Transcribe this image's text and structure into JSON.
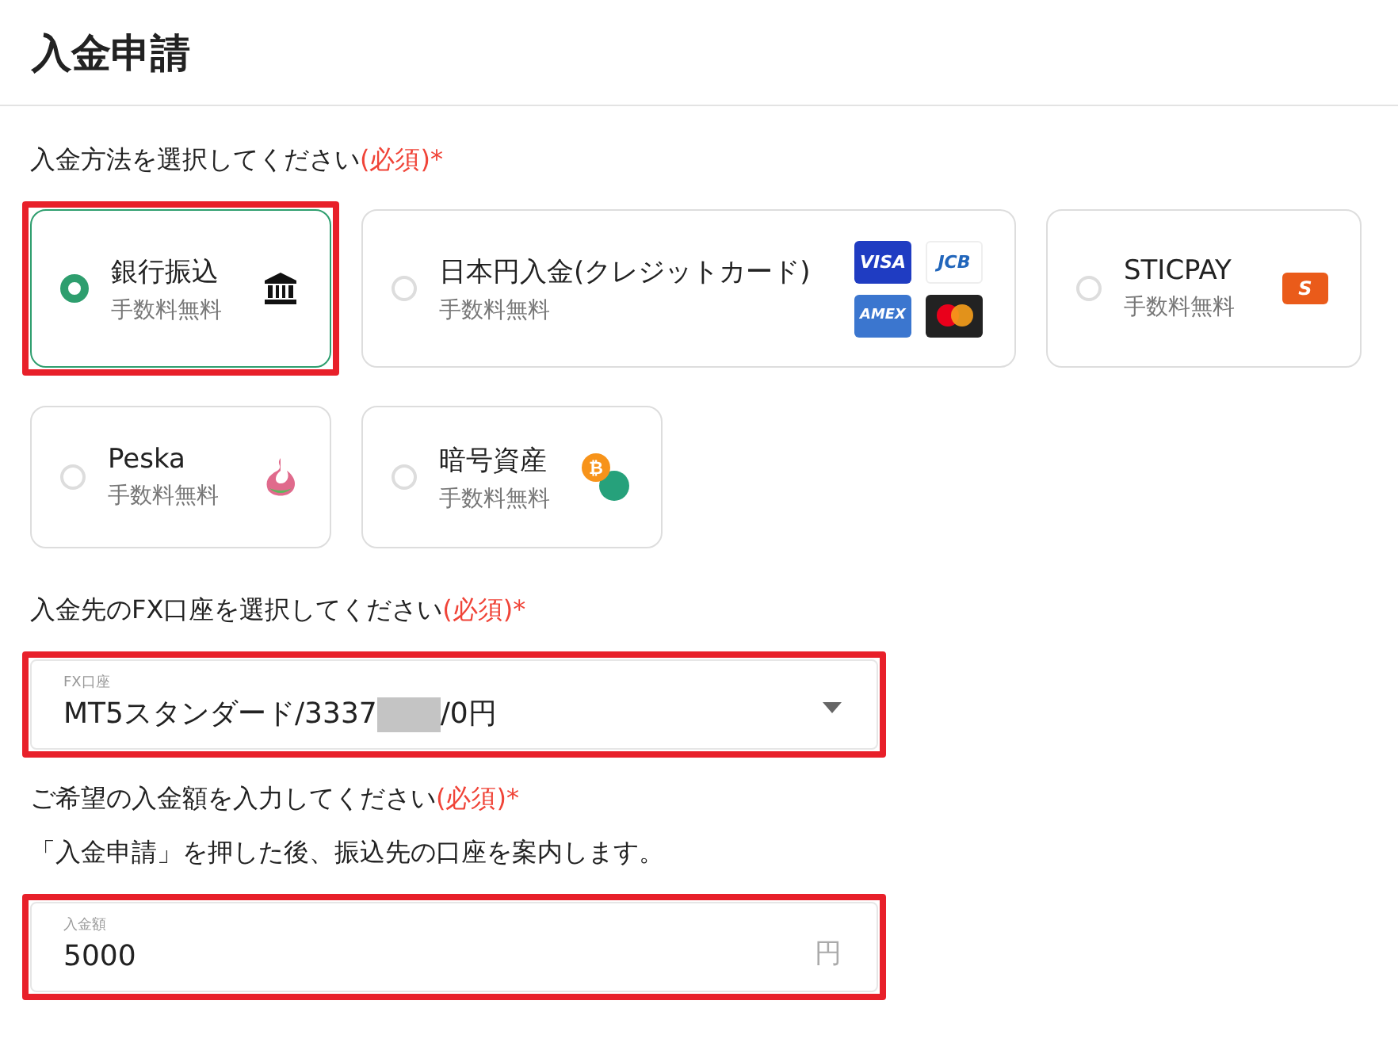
{
  "page_title": "入金申請",
  "method_section": {
    "label": "入金方法を選択してください",
    "required": "(必須)*"
  },
  "methods": [
    {
      "name": "銀行振込",
      "fee": "手数料無料",
      "selected": true,
      "highlighted": true,
      "kind": "bank"
    },
    {
      "name": "日本円入金(クレジットカード)",
      "fee": "手数料無料",
      "selected": false,
      "highlighted": false,
      "kind": "cards",
      "brands": [
        "VISA",
        "JCB",
        "AMEX"
      ]
    },
    {
      "name": "STICPAY",
      "fee": "手数料無料",
      "selected": false,
      "highlighted": false,
      "kind": "sticpay",
      "badge": "S"
    },
    {
      "name": "Peska",
      "fee": "手数料無料",
      "selected": false,
      "highlighted": false,
      "kind": "peska"
    },
    {
      "name": "暗号資産",
      "fee": "手数料無料",
      "selected": false,
      "highlighted": false,
      "kind": "crypto",
      "coin": "₿"
    }
  ],
  "account_section": {
    "label": "入金先のFX口座を選択してください",
    "required": "(必須)*"
  },
  "account_select": {
    "floating_label": "FX口座",
    "value_before": "MT5スタンダード/3337",
    "redacted": true,
    "value_after": "/0円",
    "highlighted": true
  },
  "amount_section": {
    "label": "ご希望の入金額を入力してください",
    "required": "(必須)*",
    "note": "「入金申請」を押した後、振込先の口座を案内します。"
  },
  "amount_field": {
    "floating_label": "入金額",
    "value": "5000",
    "unit": "円",
    "highlighted": true
  }
}
